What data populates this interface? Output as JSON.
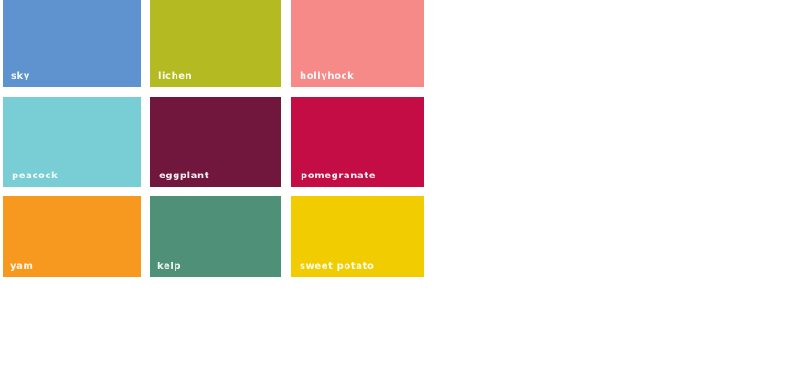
{
  "swatches": [
    {
      "label": "sky",
      "color": "#5f93cf"
    },
    {
      "label": "lichen",
      "color": "#b4bb22"
    },
    {
      "label": "hollyhock",
      "color": "#f58a88"
    },
    {
      "label": "peacock",
      "color": "#78ced4"
    },
    {
      "label": "eggplant",
      "color": "#71163d"
    },
    {
      "label": "pomegranate",
      "color": "#c40d45"
    },
    {
      "label": "yam",
      "color": "#f8991f"
    },
    {
      "label": "kelp",
      "color": "#4f9078"
    },
    {
      "label": "sweet potato",
      "color": "#f0cc00"
    }
  ]
}
